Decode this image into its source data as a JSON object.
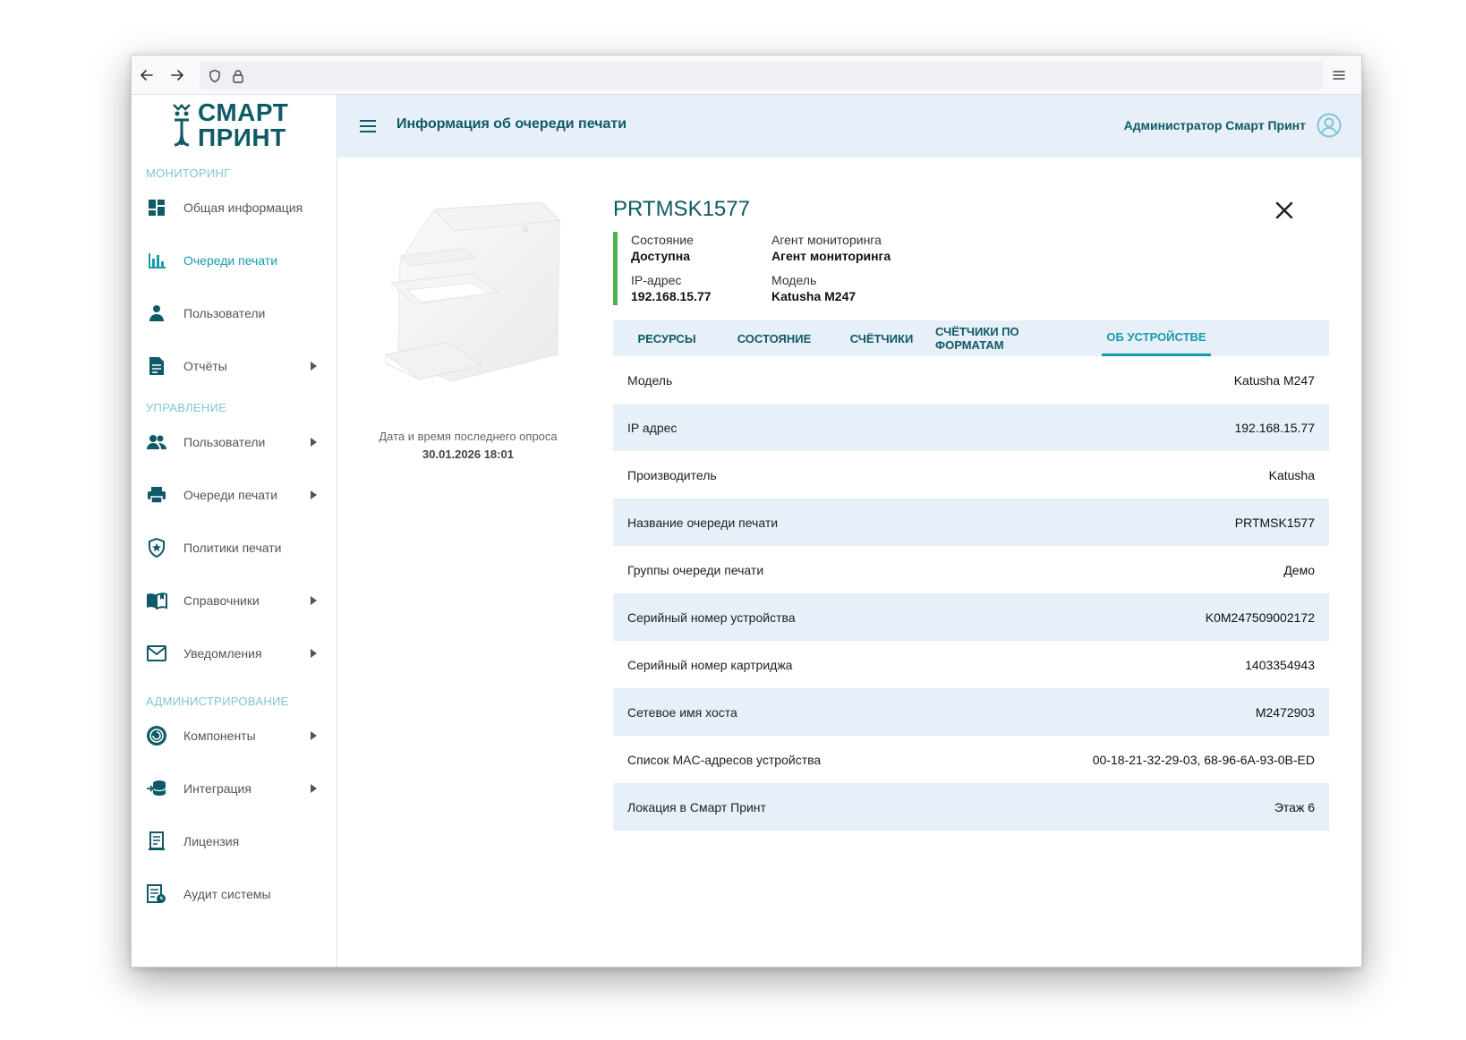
{
  "app": {
    "logo_line1": "СМАРТ",
    "logo_line2": "ПРИНТ",
    "page_title": "Информация об очереди печати",
    "user_name": "Администратор Смарт Принт"
  },
  "colors": {
    "accent": "#1a9aad",
    "brand": "#0e5a66",
    "status_ok": "#4bb34b",
    "topbar_bg": "#e7eff9"
  },
  "sidebar": {
    "sections": [
      {
        "title": "МОНИТОРИНГ"
      },
      {
        "title": "УПРАВЛЕНИЕ"
      },
      {
        "title": "АДМИНИСТРИРОВАНИЕ"
      }
    ],
    "items": [
      {
        "label": "Общая информация",
        "icon": "dashboard-icon",
        "active": false,
        "has_submenu": false
      },
      {
        "label": "Очереди печати",
        "icon": "bar-chart-icon",
        "active": true,
        "has_submenu": false
      },
      {
        "label": "Пользователи",
        "icon": "user-icon",
        "active": false,
        "has_submenu": false
      },
      {
        "label": "Отчёты",
        "icon": "report-icon",
        "active": false,
        "has_submenu": true
      },
      {
        "label": "Пользователи",
        "icon": "users-icon",
        "active": false,
        "has_submenu": true
      },
      {
        "label": "Очереди печати",
        "icon": "printer-icon",
        "active": false,
        "has_submenu": true
      },
      {
        "label": "Политики печати",
        "icon": "shield-icon",
        "active": false,
        "has_submenu": false
      },
      {
        "label": "Справочники",
        "icon": "book-icon",
        "active": false,
        "has_submenu": true
      },
      {
        "label": "Уведомления",
        "icon": "mail-icon",
        "active": false,
        "has_submenu": true
      },
      {
        "label": "Компоненты",
        "icon": "components-icon",
        "active": false,
        "has_submenu": true
      },
      {
        "label": "Интеграция",
        "icon": "integration-icon",
        "active": false,
        "has_submenu": true
      },
      {
        "label": "Лицензия",
        "icon": "license-icon",
        "active": false,
        "has_submenu": false
      },
      {
        "label": "Аудит системы",
        "icon": "audit-icon",
        "active": false,
        "has_submenu": false
      }
    ]
  },
  "device": {
    "name": "PRTMSK1577",
    "last_poll_label": "Дата и время последнего опроса",
    "last_poll_value": "30.01.2026 18:01",
    "info": {
      "state_label": "Состояние",
      "state_value": "Доступна",
      "agent_label": "Агент мониторинга",
      "agent_value": "Агент мониторинга",
      "ip_label": "IP-адрес",
      "ip_value": "192.168.15.77",
      "model_label": "Модель",
      "model_value": "Katusha M247"
    }
  },
  "tabs": [
    {
      "label": "РЕСУРСЫ",
      "active": false
    },
    {
      "label": "СОСТОЯНИЕ",
      "active": false
    },
    {
      "label": "СЧЁТЧИКИ",
      "active": false
    },
    {
      "label": "СЧЁТЧИКИ ПО ФОРМАТАМ",
      "active": false
    },
    {
      "label": "ОБ УСТРОЙСТВЕ",
      "active": true
    }
  ],
  "details": [
    {
      "label": "Модель",
      "value": "Katusha M247"
    },
    {
      "label": "IP адрес",
      "value": "192.168.15.77"
    },
    {
      "label": "Производитель",
      "value": "Katusha"
    },
    {
      "label": "Название очереди печати",
      "value": "PRTMSK1577"
    },
    {
      "label": "Группы очереди печати",
      "value": "Демо"
    },
    {
      "label": "Серийный номер устройства",
      "value": "K0M247509002172"
    },
    {
      "label": "Серийный номер картриджа",
      "value": "1403354943"
    },
    {
      "label": "Сетевое имя хоста",
      "value": "M2472903"
    },
    {
      "label": "Список MAC-адресов устройства",
      "value": "00-18-21-32-29-03, 68-96-6A-93-0B-ED"
    },
    {
      "label": "Локация в Смарт Принт",
      "value": "Этаж 6"
    }
  ]
}
